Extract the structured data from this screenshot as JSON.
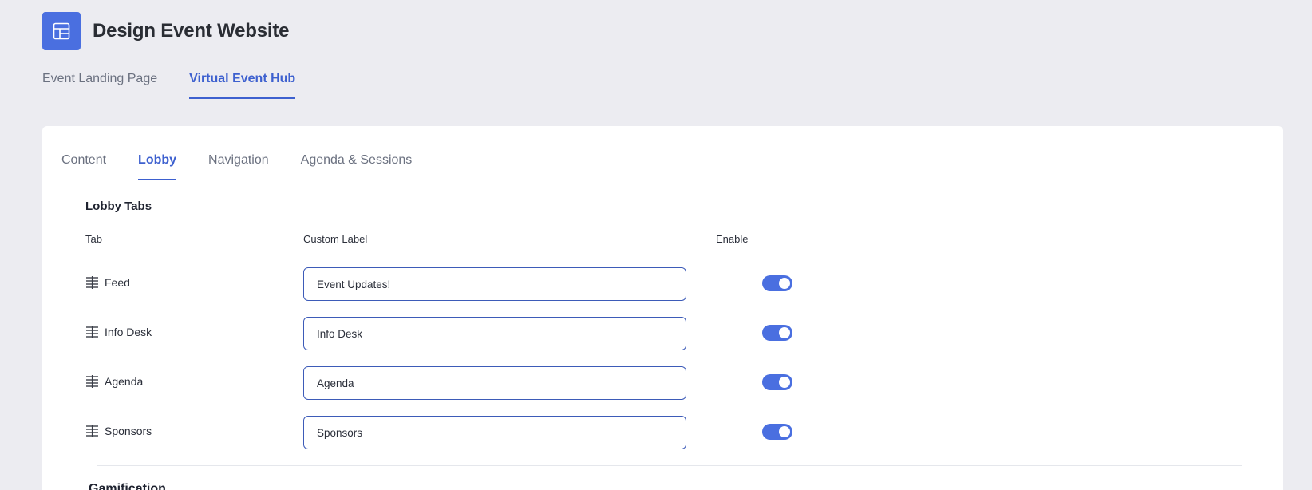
{
  "header": {
    "title": "Design Event Website",
    "logo_icon": "layout-icon",
    "accent_color": "#4a6fe0"
  },
  "top_tabs": [
    {
      "label": "Event Landing Page",
      "active": false
    },
    {
      "label": "Virtual Event Hub",
      "active": true
    }
  ],
  "sub_tabs": [
    {
      "label": "Content",
      "active": false
    },
    {
      "label": "Lobby",
      "active": true
    },
    {
      "label": "Navigation",
      "active": false
    },
    {
      "label": "Agenda & Sessions",
      "active": false
    }
  ],
  "lobby_tabs": {
    "title": "Lobby Tabs",
    "columns": {
      "tab": "Tab",
      "custom_label": "Custom Label",
      "enable": "Enable"
    },
    "rows": [
      {
        "tab": "Feed",
        "custom_label": "Event Updates!",
        "enabled": true
      },
      {
        "tab": "Info Desk",
        "custom_label": "Info Desk",
        "enabled": true
      },
      {
        "tab": "Agenda",
        "custom_label": "Agenda",
        "enabled": true
      },
      {
        "tab": "Sponsors",
        "custom_label": "Sponsors",
        "enabled": true
      }
    ]
  },
  "next_section": {
    "title": "Gamification"
  }
}
